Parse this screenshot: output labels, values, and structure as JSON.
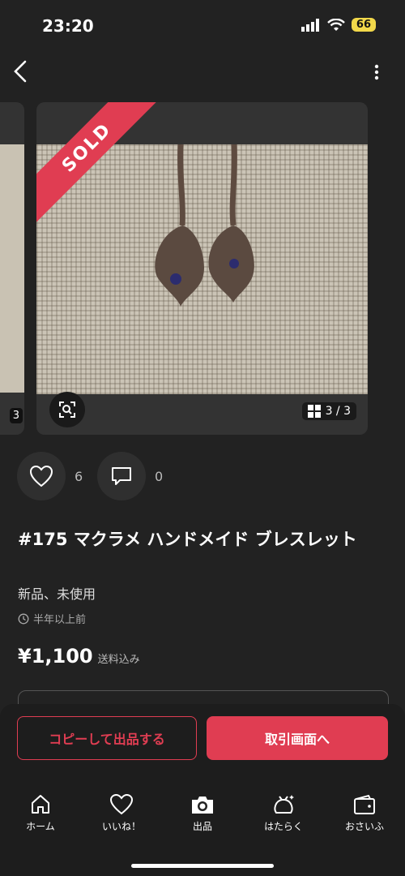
{
  "status_bar": {
    "time": "23:20",
    "battery": "66"
  },
  "gallery": {
    "prev_counter": "3",
    "sold_label": "SOLD",
    "counter": "3 / 3"
  },
  "actions": {
    "likes": "6",
    "comments": "0"
  },
  "item": {
    "title": "#175 マクラメ ハンドメイド ブレスレット",
    "condition": "新品、未使用",
    "posted": "半年以上前",
    "price": "¥1,100",
    "shipping": "送料込み"
  },
  "buttons": {
    "copy": "コピーして出品する",
    "trade": "取引画面へ"
  },
  "tabs": [
    {
      "label": "ホーム",
      "icon": "home-icon"
    },
    {
      "label": "いいね！",
      "icon": "heart-icon"
    },
    {
      "label": "出品",
      "icon": "camera-icon"
    },
    {
      "label": "はたらく",
      "icon": "bag-icon"
    },
    {
      "label": "おさいふ",
      "icon": "wallet-icon"
    }
  ],
  "colors": {
    "accent": "#e03d52",
    "background": "#222222",
    "battery": "#f2d84a"
  }
}
